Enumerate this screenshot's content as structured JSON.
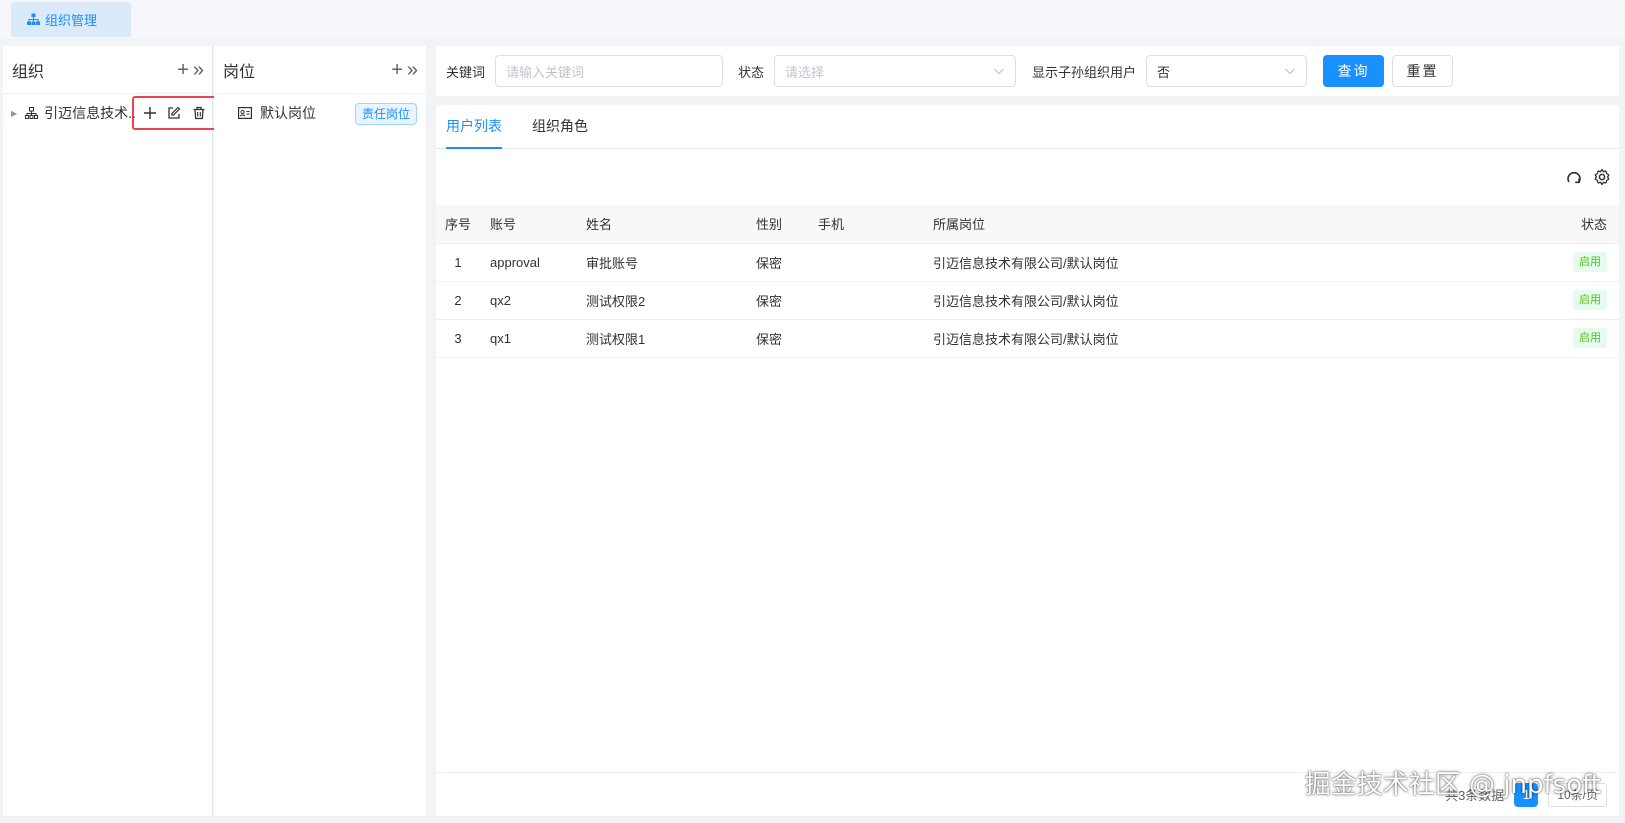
{
  "top_tab": {
    "label": "组织管理"
  },
  "org_panel": {
    "title": "组织",
    "add": "+",
    "collapse": "»",
    "tree": [
      {
        "label": "引迈信息技术..."
      }
    ]
  },
  "post_panel": {
    "title": "岗位",
    "add": "+",
    "collapse": "»",
    "items": [
      {
        "label": "默认岗位",
        "tag": "责任岗位"
      }
    ]
  },
  "search": {
    "keyword_label": "关键词",
    "keyword_placeholder": "请输入关键词",
    "status_label": "状态",
    "status_placeholder": "请选择",
    "show_sub_label": "显示子孙组织用户",
    "show_sub_value": "否",
    "query_button": "查询",
    "reset_button": "重置"
  },
  "tabs": [
    {
      "label": "用户列表"
    },
    {
      "label": "组织角色"
    }
  ],
  "table": {
    "headers": [
      "序号",
      "账号",
      "姓名",
      "性别",
      "手机",
      "所属岗位",
      "状态"
    ],
    "rows": [
      {
        "idx": "1",
        "account": "approval",
        "name": "审批账号",
        "gender": "保密",
        "phone": "",
        "post": "引迈信息技术有限公司/默认岗位",
        "status": "启用"
      },
      {
        "idx": "2",
        "account": "qx2",
        "name": "测试权限2",
        "gender": "保密",
        "phone": "",
        "post": "引迈信息技术有限公司/默认岗位",
        "status": "启用"
      },
      {
        "idx": "3",
        "account": "qx1",
        "name": "测试权限1",
        "gender": "保密",
        "phone": "",
        "post": "引迈信息技术有限公司/默认岗位",
        "status": "启用"
      }
    ]
  },
  "footer": {
    "total": "共3条数据",
    "page": "1",
    "page_size": "10条/页"
  },
  "watermark": "掘金技术社区 @ jnpfsoft",
  "colors": {
    "primary": "#1890ff",
    "highlight_border": "#e8434f",
    "success": "#52c41a"
  }
}
